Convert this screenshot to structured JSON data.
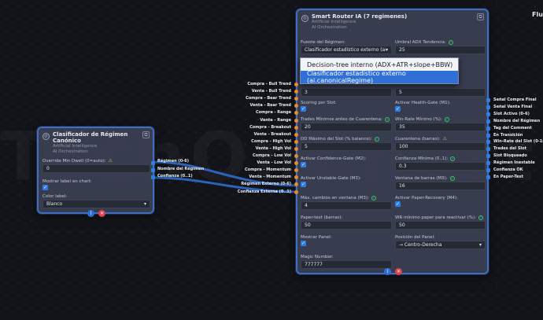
{
  "watermark": "TechOnChart",
  "left_node": {
    "title": "Clasificador de Régimen Canónico",
    "category": "Artificial Intelligence",
    "subcategory": "AI Orchestration",
    "copy_icon": "copy-icon",
    "fields": {
      "override_label": "Override Min Dwell (0=auto):",
      "override_value": "0",
      "show_label": "Mostrar label en chart:",
      "color_label": "Color label:",
      "color_value": "Blanco"
    },
    "outputs": [
      "Régimen (0-6)",
      "Nombre del Régimen",
      "Confianza (0..1)"
    ]
  },
  "right_node": {
    "title": "Smart Router IA (7 regimenes)",
    "category": "Artificial Intelligence",
    "subcategory": "AI Orchestration",
    "inputs": [
      "Compra - Bull Trend",
      "Venta - Bull Trend",
      "Compra - Bear Trend",
      "Venta - Bear Trend",
      "Compra - Range",
      "Venta - Range",
      "Compra - Breakout",
      "Venta - Breakout",
      "Compra - High Vol",
      "Venta - High Vol",
      "Compra - Low Vol",
      "Venta - Low Vol",
      "Compra - Momentum",
      "Venta - Momentum",
      "Régimen Externo (0-6)",
      "Confianza Externa (0..1)"
    ],
    "outputs": [
      "Señal Compra Final",
      "Señal Venta Final",
      "Slot Activo (0-6)",
      "Nombre del Régimen",
      "Tag del Comment",
      "En Transición",
      "Win-Rate del Slot (0-100)",
      "Trades del Slot",
      "Slot Bloqueado",
      "Régimen Inestable",
      "Confianza OK",
      "En Paper-Test"
    ],
    "fields": {
      "fuente_label": "Fuente del Régimen:",
      "fuente_value": "Clasificador estadístico externo (ai.can",
      "umbral_label": "Umbral ADX Tendencia:",
      "umbral_value": "25",
      "f3_left_value": "3",
      "f3_right_value": "5",
      "scoring_label": "Scoring por Slot:",
      "health_label": "Activar Health-Gate (M1):",
      "trades_min_label": "Trades Mínimos antes de Cuarentena:",
      "trades_min_value": "20",
      "winrate_label": "Win-Rate Mínimo (%):",
      "winrate_value": "35",
      "dd_label": "DD Máximo del Slot (% balance):",
      "dd_value": "5",
      "cuarentena_label": "Cuarentena (barras):",
      "cuarentena_value": "100",
      "conf_gate_label": "Activar Confidence-Gate (M2):",
      "conf_min_label": "Confianza Mínima (0..1):",
      "conf_min_value": "0.3",
      "unstable_label": "Activar Unstable-Gate (M3):",
      "ventana_label": "Ventana de barras (M3):",
      "ventana_value": "16",
      "max_cambios_label": "Máx. cambios en ventana (M3):",
      "max_cambios_value": "4",
      "paper_rec_label": "Activar Paper-Recovery (M4):",
      "paper_test_label": "Paper-test (barras):",
      "paper_test_value": "50",
      "wr_paper_label": "WR mínimo paper para reactivar (%):",
      "wr_paper_value": "50",
      "mostrar_panel_label": "Mostrar Panel:",
      "posicion_label": "Posición del Panel:",
      "posicion_value": "→ Centro-Derecha",
      "magic_label": "Magic Number:",
      "magic_value": "777777"
    },
    "dropdown_options": [
      "Decision-tree interno (ADX+ATR+slope+BBW)",
      "Clasificador estadístico externo (ai.canonicalRegime)"
    ]
  },
  "right_edge_label": "Flu",
  "colors": {
    "node_border": "#3f6fc4",
    "wire": "#2f6fd6",
    "input_port": "#e38c2b",
    "output_port": "#2f7de0",
    "ok": "#3fc46a",
    "warn": "#e8b23a",
    "delete": "#d9434a"
  }
}
